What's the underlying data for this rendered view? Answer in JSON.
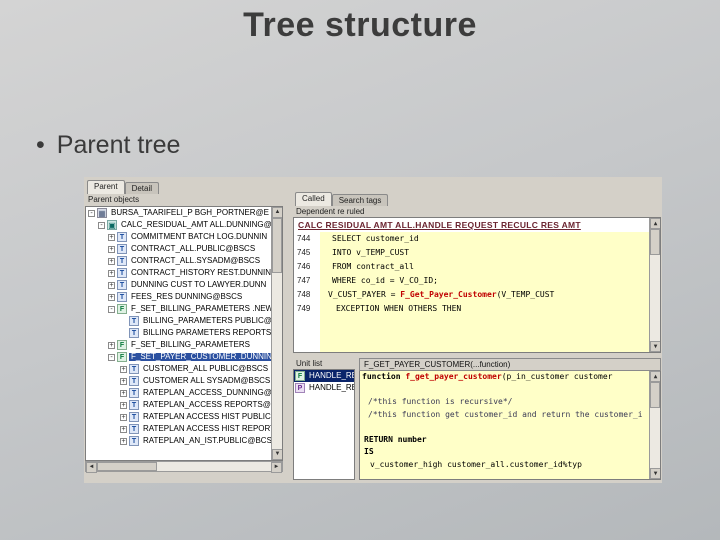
{
  "slide": {
    "title": "Tree structure",
    "bullet_marker": "•",
    "bullet_text": "Parent tree"
  },
  "left": {
    "tabs": [
      "Parent",
      "Detail"
    ],
    "header": "Parent objects",
    "tree": [
      {
        "exp": "-",
        "icon": "▦",
        "label": "BURSA_TAARIFELI_P BGH_PORTNER@E"
      },
      {
        "exp": "-",
        "icon": "▣",
        "label": "CALC_RESIDUAL_AMT ALL.DUNNING@E"
      },
      {
        "exp": "+",
        "icon": "T",
        "label": "COMMITMENT BATCH LOG.DUNNIN"
      },
      {
        "exp": "+",
        "icon": "T",
        "label": "CONTRACT_ALL.PUBLIC@BSCS"
      },
      {
        "exp": "+",
        "icon": "T",
        "label": "CONTRACT_ALL.SYSADM@BSCS"
      },
      {
        "exp": "+",
        "icon": "T",
        "label": "CONTRACT_HISTORY REST.DUNNIN"
      },
      {
        "exp": "+",
        "icon": "T",
        "label": "DUNNING CUST TO LAWYER.DUNN"
      },
      {
        "exp": "+",
        "icon": "T",
        "label": "FEES_RES DUNNING@BSCS"
      },
      {
        "exp": "-",
        "icon": "F",
        "label": "F_SET_BILLING_PARAMETERS .NEW"
      },
      {
        "exp": "",
        "icon": "T",
        "label": "BILLING_PARAMETERS PUBLIC@"
      },
      {
        "exp": "",
        "icon": "T",
        "label": "BILLING PARAMETERS REPORTS"
      },
      {
        "exp": "+",
        "icon": "F",
        "label": "F_SET_BILLING_PARAMETERS"
      },
      {
        "exp": "-",
        "icon": "F",
        "label": "F_SET_PAYER_CUSTOMER .DUNNIN",
        "selected": true
      },
      {
        "exp": "+",
        "icon": "T",
        "label": "CUSTOMER_ALL PUBLIC@BSCS"
      },
      {
        "exp": "+",
        "icon": "T",
        "label": "CUSTOMER ALL SYSADM@BSCS"
      },
      {
        "exp": "+",
        "icon": "T",
        "label": "RATEPLAN_ACCESS_DUNNING@BSC"
      },
      {
        "exp": "+",
        "icon": "T",
        "label": "RATEPLAN_ACCESS REPORTS@BSC"
      },
      {
        "exp": "+",
        "icon": "T",
        "label": "RATEPLAN ACCESS HIST PUBLIC@"
      },
      {
        "exp": "+",
        "icon": "T",
        "label": "RATEPLAN ACCESS HIST REPORTS"
      },
      {
        "exp": "+",
        "icon": "T",
        "label": "RATEPLAN_AN_IST.PUBLIC@BCS"
      }
    ]
  },
  "rtop": {
    "tabs": [
      "Called",
      "Search tags"
    ],
    "header": "Dependent re ruled",
    "code_title": "CALC RESIDUAL AMT ALL.HANDLE REQUEST RECULC RES AMT",
    "lines": [
      {
        "n": "744",
        "pre": "SELECT customer_id",
        "hot": "",
        "post": ""
      },
      {
        "n": "745",
        "pre": "INTO v_TEMP_CUST",
        "hot": "",
        "post": ""
      },
      {
        "n": "746",
        "pre": "FROM contract_all",
        "hot": "",
        "post": ""
      },
      {
        "n": "747",
        "pre": "WHERE co_id = V_CO_ID;",
        "hot": "",
        "post": ""
      },
      {
        "n": "748",
        "pre": "V_CUST_PAYER = ",
        "hot": "F_Get_Payer_Customer",
        "post": "(V_TEMP_CUST"
      },
      {
        "n": "749",
        "pre": "EXCEPTION WHEN OTHERS THEN",
        "hot": "",
        "post": ""
      }
    ]
  },
  "rbot": {
    "list_header": "Unit list",
    "items": [
      {
        "icon": "F",
        "label": "HANDLE_RE"
      },
      {
        "icon": "P",
        "label": "HANDLE_RE"
      }
    ],
    "func_title": "F_GET_PAYER_CUSTOMER(...function)",
    "lines": [
      {
        "pre": "function ",
        "hot": "f_get_payer_customer",
        "post": "(p_in_customer customer"
      },
      {
        "pre": "",
        "hot": "",
        "post": ""
      },
      {
        "pre": "/*this function is recursive*/",
        "hot": "",
        "post": ""
      },
      {
        "pre": "/*this function get customer_id and return the customer_i",
        "hot": "",
        "post": ""
      },
      {
        "pre": "",
        "hot": "",
        "post": ""
      },
      {
        "pre": "RETURN number",
        "hot": "",
        "post": ""
      },
      {
        "pre": "IS",
        "hot": "",
        "post": ""
      },
      {
        "pre": "v_customer_high customer_all.customer_id%typ",
        "hot": "",
        "post": ""
      }
    ]
  },
  "icons": {
    "scroll_up": "▲",
    "scroll_down": "▼",
    "scroll_left": "◄",
    "scroll_right": "►"
  }
}
